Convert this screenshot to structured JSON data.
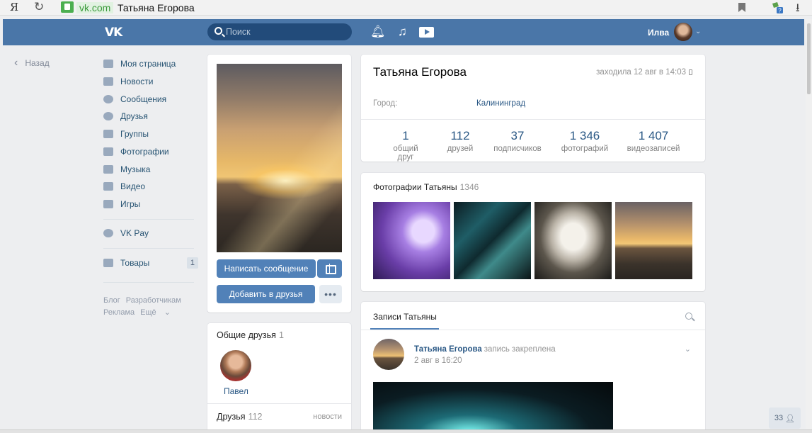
{
  "browser": {
    "logo": "Я",
    "domain": "vk.com",
    "title": "Татьяна Егорова"
  },
  "header": {
    "logo": "VK",
    "search_placeholder": "Поиск",
    "user_name": "Илва"
  },
  "sidebar": {
    "back_label": "Назад",
    "items": [
      {
        "label": "Моя страница",
        "icon": "home-icon"
      },
      {
        "label": "Новости",
        "icon": "news-icon"
      },
      {
        "label": "Сообщения",
        "icon": "messages-icon"
      },
      {
        "label": "Друзья",
        "icon": "friends-icon"
      },
      {
        "label": "Группы",
        "icon": "groups-icon"
      },
      {
        "label": "Фотографии",
        "icon": "camera-icon"
      },
      {
        "label": "Музыка",
        "icon": "music-icon"
      },
      {
        "label": "Видео",
        "icon": "video-icon"
      },
      {
        "label": "Игры",
        "icon": "gamepad-icon"
      }
    ],
    "vkpay_label": "VK Pay",
    "goods_label": "Товары",
    "goods_badge": "1",
    "footer": {
      "blog": "Блог",
      "developers": "Разработчикам",
      "ads": "Реклама",
      "more": "Ещё"
    }
  },
  "profile_photo": {
    "message_button": "Написать сообщение",
    "add_friend_button": "Добавить в друзья",
    "more_button": "•••"
  },
  "mutual_friends": {
    "title": "Общие друзья",
    "count": "1",
    "friend_name": "Павел",
    "friends_title": "Друзья",
    "friends_count": "112",
    "news_link": "новости"
  },
  "profile": {
    "name": "Татьяна Егорова",
    "last_seen": "заходила 12 авг в 14:03",
    "city_label": "Город:",
    "city": "Калининград",
    "stats": [
      {
        "value": "1",
        "label": "общий друг"
      },
      {
        "value": "112",
        "label": "друзей"
      },
      {
        "value": "37",
        "label": "подписчиков"
      },
      {
        "value": "1 346",
        "label": "фотографий"
      },
      {
        "value": "1 407",
        "label": "видеозаписей"
      }
    ]
  },
  "photos": {
    "title": "Фотографии Татьяны",
    "count": "1346"
  },
  "wall": {
    "tab": "Записи Татьяны",
    "post_author": "Татьяна Егорова",
    "post_pinned": "запись закреплена",
    "post_date": "2 авг в 16:20"
  },
  "chat_counter": "33"
}
